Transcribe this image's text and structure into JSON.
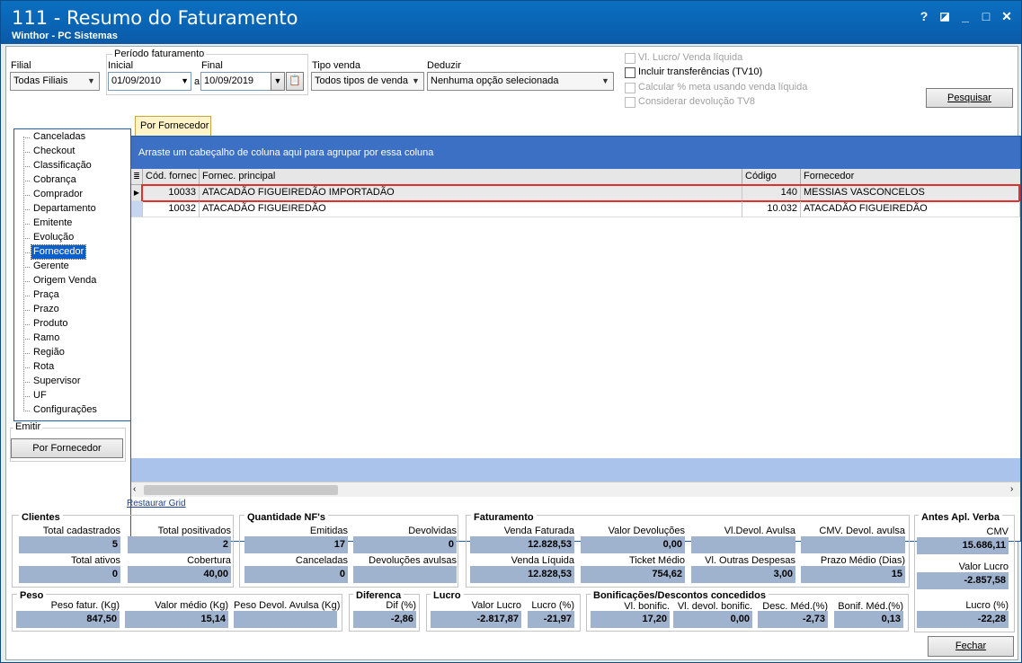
{
  "window": {
    "title": "111 - Resumo do Faturamento",
    "subtitle": "Winthor - PC Sistemas",
    "controls": [
      "?",
      "◪",
      "_",
      "□",
      "✕"
    ]
  },
  "filters": {
    "filial_label": "Filial",
    "filial_value": "Todas Filiais",
    "periodo_label": "Período faturamento",
    "inicial_label": "Inicial",
    "inicial_value": "01/09/2010",
    "a_label": "a",
    "final_label": "Final",
    "final_value": "10/09/2019",
    "tipo_venda_label": "Tipo venda",
    "tipo_venda_value": "Todos tipos de venda",
    "deduzir_label": "Deduzir",
    "deduzir_value": "Nenhuma opção selecionada",
    "checkboxes": [
      {
        "label": "Vl. Lucro/ Venda líquida",
        "enabled": false,
        "checked": false
      },
      {
        "label": "Incluir transferências  (TV10)",
        "enabled": true,
        "checked": false
      },
      {
        "label": "Calcular % meta usando venda líquida",
        "enabled": false,
        "checked": false
      },
      {
        "label": "Considerar devolução TV8",
        "enabled": false,
        "checked": false
      }
    ],
    "pesquisar_label": "Pesquisar"
  },
  "tree": {
    "items": [
      "Canceladas",
      "Checkout",
      "Classificação",
      "Cobrança",
      "Comprador",
      "Departamento",
      "Emitente",
      "Evolução",
      "Fornecedor",
      "Gerente",
      "Origem Venda",
      "Praça",
      "Prazo",
      "Produto",
      "Ramo",
      "Região",
      "Rota",
      "Supervisor",
      "UF",
      "Configurações"
    ],
    "selected": "Fornecedor"
  },
  "emitir": {
    "label": "Emitir",
    "button_label": "Por Fornecedor"
  },
  "tab": {
    "label": "Por Fornecedor"
  },
  "grid": {
    "group_hint": "Arraste um cabeçalho de coluna aqui para agrupar por essa coluna",
    "columns": [
      "Cód. fornec",
      "Fornec. principal",
      "Código",
      "Fornecedor"
    ],
    "rows": [
      [
        "10033",
        "ATACADÃO FIGUEIREDÃO IMPORTADÃO",
        "140",
        "MESSIAS VASCONCELOS"
      ],
      [
        "10032",
        "ATACADÃO FIGUEIREDÃO",
        "10.032",
        "ATACADÃO FIGUEIREDÃO"
      ]
    ]
  },
  "restaurar_grid": "Restaurar Grid",
  "clientes": {
    "title": "Clientes",
    "total_cadastrados_label": "Total cadastrados",
    "total_cadastrados": "5",
    "total_positivados_label": "Total positivados",
    "total_positivados": "2",
    "total_ativos_label": "Total ativos",
    "total_ativos": "0",
    "cobertura_label": "Cobertura",
    "cobertura": "40,00"
  },
  "quantidade": {
    "title": "Quantidade NF's",
    "emitidas_label": "Emitidas",
    "emitidas": "17",
    "devolvidas_label": "Devolvidas",
    "devolvidas": "0",
    "canceladas_label": "Canceladas",
    "canceladas": "0",
    "dev_avulsas_label": "Devoluções avulsas",
    "dev_avulsas": ""
  },
  "faturamento": {
    "title": "Faturamento",
    "venda_faturada_label": "Venda Faturada",
    "venda_faturada": "12.828,53",
    "valor_devolucoes_label": "Valor Devoluções",
    "valor_devolucoes": "0,00",
    "vl_devol_avulsa_label": "Vl.Devol. Avulsa",
    "vl_devol_avulsa": "",
    "cmv_devol_label": "CMV. Devol. avulsa",
    "cmv_devol": "",
    "venda_liquida_label": "Venda Líquida",
    "venda_liquida": "12.828,53",
    "ticket_medio_label": "Ticket Médio",
    "ticket_medio": "754,62",
    "outras_despesas_label": "Vl. Outras Despesas",
    "outras_despesas": "3,00",
    "prazo_medio_label": "Prazo Médio (Dias)",
    "prazo_medio": "15"
  },
  "antes": {
    "title": "Antes Apl. Verba",
    "cmv_label": "CMV",
    "cmv": "15.686,11",
    "valor_lucro_label": "Valor Lucro",
    "valor_lucro": "-2.857,58",
    "lucro_pct_label": "Lucro (%)",
    "lucro_pct": "-22,28"
  },
  "peso": {
    "title": "Peso",
    "peso_fatur_label": "Peso fatur. (Kg)",
    "peso_fatur": "847,50",
    "valor_medio_label": "Valor médio (Kg)",
    "valor_medio": "15,14",
    "peso_devol_label": "Peso Devol. Avulsa (Kg)",
    "peso_devol": ""
  },
  "diferenca": {
    "title": "Diferenca",
    "dif_label": "Dif (%)",
    "dif": "-2,86"
  },
  "lucro": {
    "title": "Lucro",
    "valor_lucro_label": "Valor Lucro",
    "valor_lucro": "-2.817,87",
    "lucro_pct_label": "Lucro (%)",
    "lucro_pct": "-21,97"
  },
  "bonificacoes": {
    "title": "Bonificações/Descontos concedidos",
    "vl_bonific_label": "Vl. bonific.",
    "vl_bonific": "17,20",
    "vl_devol_bonific_label": "Vl. devol. bonific.",
    "vl_devol_bonific": "0,00",
    "desc_med_label": "Desc. Méd.(%)",
    "desc_med": "-2,73",
    "bonif_med_label": "Bonif. Méd.(%)",
    "bonif_med": "0,13"
  },
  "fechar_label": "Fechar",
  "colors": {
    "title_bar": "#0a63b3",
    "group_bar": "#3b70c4",
    "value_box": "#9fb3cf",
    "selection_border": "#e03030"
  }
}
